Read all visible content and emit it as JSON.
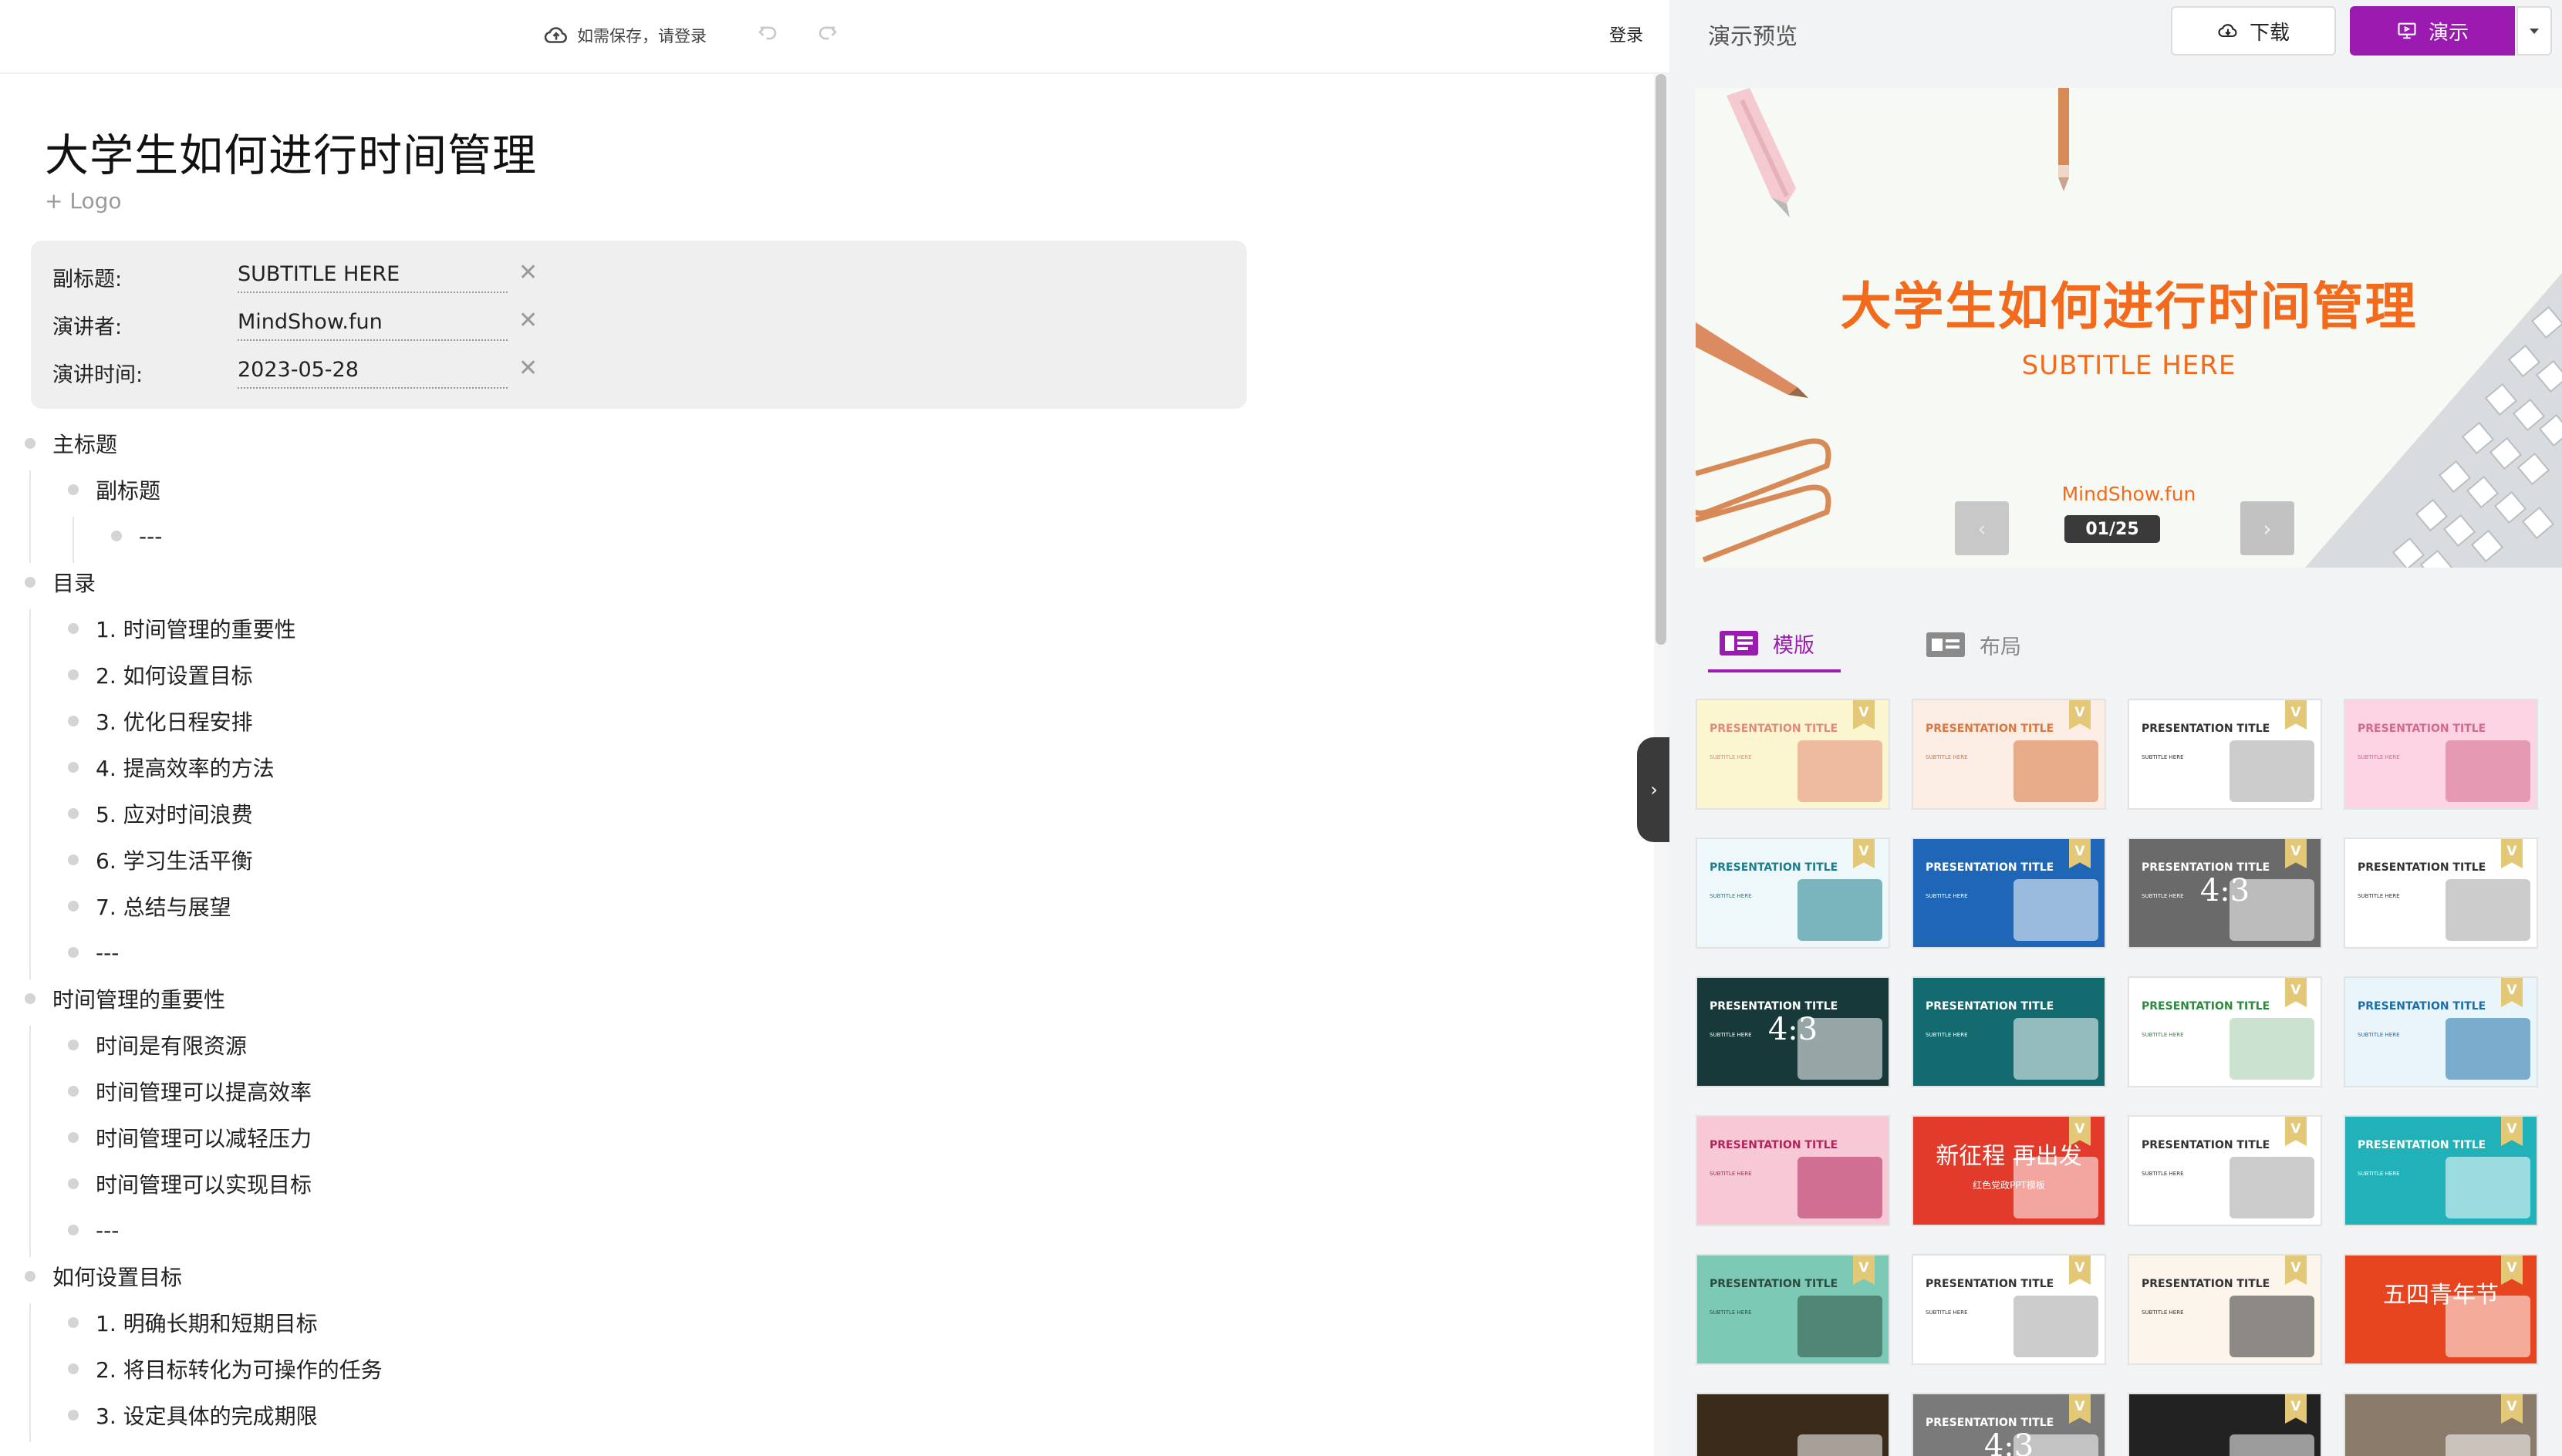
{
  "topbar": {
    "save_hint": "如需保存，请登录",
    "login": "登录"
  },
  "doc": {
    "title": "大学生如何进行时间管理",
    "add_logo": "+ Logo",
    "meta": [
      {
        "label": "副标题:",
        "value": "SUBTITLE HERE"
      },
      {
        "label": "演讲者:",
        "value": "MindShow.fun"
      },
      {
        "label": "演讲时间:",
        "value": "2023-05-28"
      }
    ]
  },
  "outline": [
    {
      "level": 0,
      "text": "主标题"
    },
    {
      "level": 1,
      "text": "副标题"
    },
    {
      "level": 2,
      "text": "---"
    },
    {
      "level": 0,
      "text": "目录"
    },
    {
      "level": 1,
      "text": "1. 时间管理的重要性"
    },
    {
      "level": 1,
      "text": "2. 如何设置目标"
    },
    {
      "level": 1,
      "text": "3. 优化日程安排"
    },
    {
      "level": 1,
      "text": "4. 提高效率的方法"
    },
    {
      "level": 1,
      "text": "5. 应对时间浪费"
    },
    {
      "level": 1,
      "text": "6. 学习生活平衡"
    },
    {
      "level": 1,
      "text": "7. 总结与展望"
    },
    {
      "level": 1,
      "text": "---"
    },
    {
      "level": 0,
      "text": "时间管理的重要性"
    },
    {
      "level": 1,
      "text": "时间是有限资源"
    },
    {
      "level": 1,
      "text": "时间管理可以提高效率"
    },
    {
      "level": 1,
      "text": "时间管理可以减轻压力"
    },
    {
      "level": 1,
      "text": "时间管理可以实现目标"
    },
    {
      "level": 1,
      "text": "---"
    },
    {
      "level": 0,
      "text": "如何设置目标"
    },
    {
      "level": 1,
      "text": "1. 明确长期和短期目标"
    },
    {
      "level": 1,
      "text": "2. 将目标转化为可操作的任务"
    },
    {
      "level": 1,
      "text": "3. 设定具体的完成期限"
    }
  ],
  "preview": {
    "label": "演示预览",
    "download": "下载",
    "present": "演示",
    "slide_title": "大学生如何进行时间管理",
    "slide_subtitle": "SUBTITLE HERE",
    "slide_author": "MindShow.fun",
    "slide_counter": "01/25",
    "prev_arrow": "‹",
    "next_arrow": "›"
  },
  "tabs": {
    "template": "模版",
    "layout": "布局"
  },
  "templates": [
    {
      "title": "PRESENTATION TITLE",
      "sub": "SUBTITLE HERE",
      "badge": "V",
      "bg": "#fbf6cf",
      "fg": "#e08a7a"
    },
    {
      "title": "PRESENTATION TITLE",
      "sub": "SUBTITLE HERE",
      "badge": "V",
      "bg": "#fbece4",
      "fg": "#d9773f"
    },
    {
      "title": "PRESENTATION TITLE",
      "sub": "SUBTITLE HERE",
      "badge": "V",
      "bg": "#ffffff",
      "fg": "#333333"
    },
    {
      "title": "PRESENTATION TITLE",
      "sub": "SUBTITLE HERE",
      "badge": "",
      "bg": "#fbd3e3",
      "fg": "#d46a8a"
    },
    {
      "title": "PRESENTATION TITLE",
      "sub": "SUBTITLE HERE",
      "badge": "V",
      "bg": "#eef8fb",
      "fg": "#1b7e8a"
    },
    {
      "title": "PRESENTATION TITLE",
      "sub": "SUBTITLE HERE",
      "badge": "V",
      "bg": "#1f67b6",
      "fg": "#ffffff"
    },
    {
      "title": "PRESENTATION TITLE",
      "sub": "SUBTITLE HERE",
      "badge": "V",
      "bg": "#6a6a6a",
      "fg": "#ffffff",
      "ratio": "4:3"
    },
    {
      "title": "PRESENTATION TITLE",
      "sub": "SUBTITLE HERE",
      "badge": "V",
      "bg": "#ffffff",
      "fg": "#333333"
    },
    {
      "title": "PRESENTATION TITLE",
      "sub": "SUBTITLE HERE",
      "badge": "",
      "bg": "#17393a",
      "fg": "#ffffff",
      "ratio": "4:3"
    },
    {
      "title": "PRESENTATION TITLE",
      "sub": "SUBTITLE HERE",
      "badge": "",
      "bg": "#12696e",
      "fg": "#ffffff"
    },
    {
      "title": "PRESENTATION TITLE",
      "sub": "SUBTITLE HERE",
      "badge": "V",
      "bg": "#ffffff",
      "fg": "#2b8a3e"
    },
    {
      "title": "PRESENTATION TITLE",
      "sub": "SUBTITLE HERE",
      "badge": "V",
      "bg": "#eaf4fb",
      "fg": "#1b6fa8"
    },
    {
      "title": "PRESENTATION TITLE",
      "sub": "SUBTITLE HERE",
      "badge": "",
      "bg": "#f7c9d6",
      "fg": "#b1245a"
    },
    {
      "title": "",
      "sub": "",
      "badge": "V",
      "bg": "#e23b2b",
      "fg": "#ffffff",
      "cn": "新征程 再出发",
      "cn2": "红色党政PPT模板"
    },
    {
      "title": "PRESENTATION TITLE",
      "sub": "SUBTITLE HERE",
      "badge": "V",
      "bg": "#ffffff",
      "fg": "#333333"
    },
    {
      "title": "PRESENTATION TITLE",
      "sub": "SUBTITLE HERE",
      "badge": "V",
      "bg": "#20b2b8",
      "fg": "#ffffff"
    },
    {
      "title": "PRESENTATION TITLE",
      "sub": "SUBTITLE HERE",
      "badge": "V",
      "bg": "#7cc9b6",
      "fg": "#2c4a3e"
    },
    {
      "title": "PRESENTATION TITLE",
      "sub": "SUBTITLE HERE",
      "badge": "V",
      "bg": "#ffffff",
      "fg": "#333333"
    },
    {
      "title": "PRESENTATION TITLE",
      "sub": "SUBTITLE HERE",
      "badge": "V",
      "bg": "#fbf4ea",
      "fg": "#333333"
    },
    {
      "title": "",
      "sub": "",
      "badge": "V",
      "bg": "#e6451f",
      "fg": "#ffffff",
      "cn": "五四青年节",
      "cn2": ""
    },
    {
      "title": "",
      "sub": "",
      "badge": "",
      "bg": "#3a2a1a",
      "fg": "#ffffff"
    },
    {
      "title": "PRESENTATION TITLE",
      "sub": "",
      "badge": "V",
      "bg": "#7a7a7a",
      "fg": "#ffffff",
      "ratio": "4:3"
    },
    {
      "title": "",
      "sub": "",
      "badge": "V",
      "bg": "#222222",
      "fg": "#ffffff"
    },
    {
      "title": "",
      "sub": "",
      "badge": "V",
      "bg": "#8a7a6a",
      "fg": "#ffffff"
    }
  ]
}
